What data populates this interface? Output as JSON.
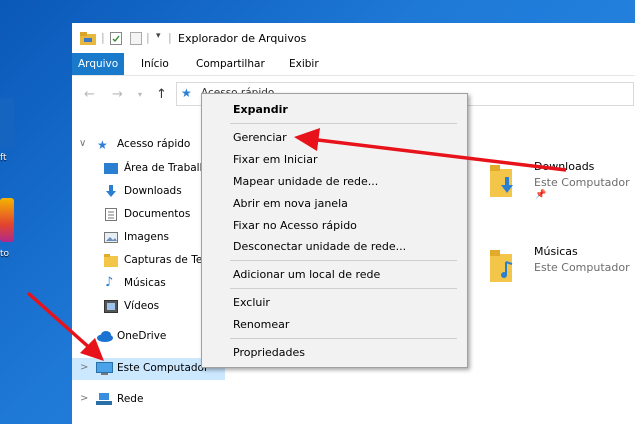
{
  "window": {
    "title": "Explorador de Arquivos"
  },
  "ribbon": {
    "tabs": [
      "Arquivo",
      "Início",
      "Compartilhar",
      "Exibir"
    ]
  },
  "desktop": {
    "labels": [
      "ft",
      "to"
    ]
  },
  "address": {
    "partial": "Acesso rápido"
  },
  "nav": {
    "quick_access": "Acesso rápido",
    "items": [
      "Área de Trabalh",
      "Downloads",
      "Documentos",
      "Imagens",
      "Capturas de Te",
      "Músicas",
      "Vídeos"
    ],
    "onedrive": "OneDrive",
    "this_pc": "Este Computador",
    "network": "Rede"
  },
  "content": {
    "folders": [
      {
        "name": "Downloads",
        "location": "Este Computador"
      },
      {
        "name": "Músicas",
        "location": "Este Computador"
      }
    ]
  },
  "context_menu": {
    "items": [
      {
        "label": "Expandir",
        "bold": true
      },
      {
        "label": "Gerenciar"
      },
      {
        "label": "Fixar em Iniciar"
      },
      {
        "label": "Mapear unidade de rede..."
      },
      {
        "label": "Abrir em nova janela"
      },
      {
        "label": "Fixar no Acesso rápido"
      },
      {
        "label": "Desconectar unidade de rede..."
      },
      {
        "label": "Adicionar um local de rede"
      },
      {
        "label": "Excluir"
      },
      {
        "label": "Renomear"
      },
      {
        "label": "Propriedades"
      }
    ]
  },
  "colors": {
    "accent": "#1979ca",
    "selected": "#cce8ff",
    "annotation": "#e8121b"
  }
}
